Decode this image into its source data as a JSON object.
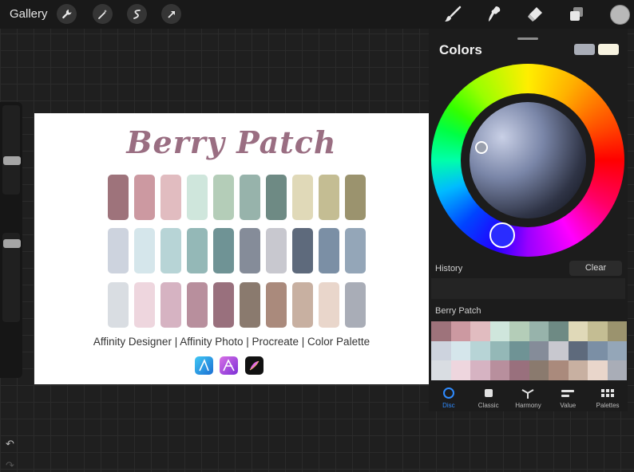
{
  "topbar": {
    "gallery_label": "Gallery",
    "left_tools": [
      "wrench-icon",
      "magic-wand-icon",
      "selection-icon",
      "transform-arrow-icon"
    ],
    "right_tools": [
      "brush-icon",
      "smudge-icon",
      "eraser-icon",
      "layers-icon"
    ],
    "current_color": "#b8b8b8"
  },
  "artwork": {
    "title": "Berry Patch",
    "title_color": "#9a6e82",
    "swatch_rows": [
      [
        "#9e737b",
        "#cc99a1",
        "#e1bcc0",
        "#cfe6dc",
        "#b4cdb8",
        "#97b3ab",
        "#6e8a84",
        "#e0d9b8",
        "#c4bd93",
        "#9b936e"
      ],
      [
        "#cdd3de",
        "#d5e6eb",
        "#b7d4d6",
        "#94b8b7",
        "#6f9395",
        "#858c99",
        "#c8c8cf",
        "#5e6a7c",
        "#7b8fa5",
        "#94a6b8"
      ],
      [
        "#d9dde2",
        "#eed6de",
        "#d6b3c2",
        "#b88f9d",
        "#99707d",
        "#8a7a6e",
        "#aa8a7c",
        "#c8b0a1",
        "#e9d6cb",
        "#a9adb7"
      ]
    ],
    "caption": "Affinity Designer | Affinity Photo | Procreate | Color Palette",
    "app_icons": [
      "affinity-designer-icon",
      "affinity-photo-icon",
      "procreate-icon"
    ]
  },
  "colors_panel": {
    "title": "Colors",
    "secondary_color": "#a9adb7",
    "primary_color": "#f7f3e0",
    "history_label": "History",
    "clear_label": "Clear",
    "palette_name": "Berry Patch",
    "tabs": [
      {
        "label": "Disc",
        "icon": "disc-icon",
        "active": true
      },
      {
        "label": "Classic",
        "icon": "classic-icon",
        "active": false
      },
      {
        "label": "Harmony",
        "icon": "harmony-icon",
        "active": false
      },
      {
        "label": "Value",
        "icon": "value-icon",
        "active": false
      },
      {
        "label": "Palettes",
        "icon": "palettes-icon",
        "active": false
      }
    ]
  }
}
